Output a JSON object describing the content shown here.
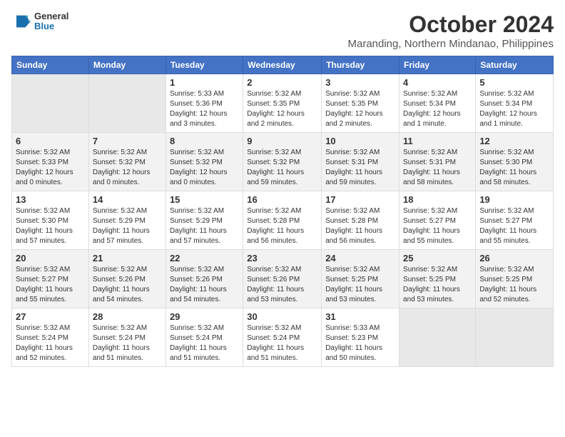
{
  "logo": {
    "general": "General",
    "blue": "Blue"
  },
  "title": "October 2024",
  "location": "Maranding, Northern Mindanao, Philippines",
  "headers": [
    "Sunday",
    "Monday",
    "Tuesday",
    "Wednesday",
    "Thursday",
    "Friday",
    "Saturday"
  ],
  "weeks": [
    [
      {
        "day": "",
        "info": ""
      },
      {
        "day": "",
        "info": ""
      },
      {
        "day": "1",
        "info": "Sunrise: 5:33 AM\nSunset: 5:36 PM\nDaylight: 12 hours and 3 minutes."
      },
      {
        "day": "2",
        "info": "Sunrise: 5:32 AM\nSunset: 5:35 PM\nDaylight: 12 hours and 2 minutes."
      },
      {
        "day": "3",
        "info": "Sunrise: 5:32 AM\nSunset: 5:35 PM\nDaylight: 12 hours and 2 minutes."
      },
      {
        "day": "4",
        "info": "Sunrise: 5:32 AM\nSunset: 5:34 PM\nDaylight: 12 hours and 1 minute."
      },
      {
        "day": "5",
        "info": "Sunrise: 5:32 AM\nSunset: 5:34 PM\nDaylight: 12 hours and 1 minute."
      }
    ],
    [
      {
        "day": "6",
        "info": "Sunrise: 5:32 AM\nSunset: 5:33 PM\nDaylight: 12 hours and 0 minutes."
      },
      {
        "day": "7",
        "info": "Sunrise: 5:32 AM\nSunset: 5:32 PM\nDaylight: 12 hours and 0 minutes."
      },
      {
        "day": "8",
        "info": "Sunrise: 5:32 AM\nSunset: 5:32 PM\nDaylight: 12 hours and 0 minutes."
      },
      {
        "day": "9",
        "info": "Sunrise: 5:32 AM\nSunset: 5:32 PM\nDaylight: 11 hours and 59 minutes."
      },
      {
        "day": "10",
        "info": "Sunrise: 5:32 AM\nSunset: 5:31 PM\nDaylight: 11 hours and 59 minutes."
      },
      {
        "day": "11",
        "info": "Sunrise: 5:32 AM\nSunset: 5:31 PM\nDaylight: 11 hours and 58 minutes."
      },
      {
        "day": "12",
        "info": "Sunrise: 5:32 AM\nSunset: 5:30 PM\nDaylight: 11 hours and 58 minutes."
      }
    ],
    [
      {
        "day": "13",
        "info": "Sunrise: 5:32 AM\nSunset: 5:30 PM\nDaylight: 11 hours and 57 minutes."
      },
      {
        "day": "14",
        "info": "Sunrise: 5:32 AM\nSunset: 5:29 PM\nDaylight: 11 hours and 57 minutes."
      },
      {
        "day": "15",
        "info": "Sunrise: 5:32 AM\nSunset: 5:29 PM\nDaylight: 11 hours and 57 minutes."
      },
      {
        "day": "16",
        "info": "Sunrise: 5:32 AM\nSunset: 5:28 PM\nDaylight: 11 hours and 56 minutes."
      },
      {
        "day": "17",
        "info": "Sunrise: 5:32 AM\nSunset: 5:28 PM\nDaylight: 11 hours and 56 minutes."
      },
      {
        "day": "18",
        "info": "Sunrise: 5:32 AM\nSunset: 5:27 PM\nDaylight: 11 hours and 55 minutes."
      },
      {
        "day": "19",
        "info": "Sunrise: 5:32 AM\nSunset: 5:27 PM\nDaylight: 11 hours and 55 minutes."
      }
    ],
    [
      {
        "day": "20",
        "info": "Sunrise: 5:32 AM\nSunset: 5:27 PM\nDaylight: 11 hours and 55 minutes."
      },
      {
        "day": "21",
        "info": "Sunrise: 5:32 AM\nSunset: 5:26 PM\nDaylight: 11 hours and 54 minutes."
      },
      {
        "day": "22",
        "info": "Sunrise: 5:32 AM\nSunset: 5:26 PM\nDaylight: 11 hours and 54 minutes."
      },
      {
        "day": "23",
        "info": "Sunrise: 5:32 AM\nSunset: 5:26 PM\nDaylight: 11 hours and 53 minutes."
      },
      {
        "day": "24",
        "info": "Sunrise: 5:32 AM\nSunset: 5:25 PM\nDaylight: 11 hours and 53 minutes."
      },
      {
        "day": "25",
        "info": "Sunrise: 5:32 AM\nSunset: 5:25 PM\nDaylight: 11 hours and 53 minutes."
      },
      {
        "day": "26",
        "info": "Sunrise: 5:32 AM\nSunset: 5:25 PM\nDaylight: 11 hours and 52 minutes."
      }
    ],
    [
      {
        "day": "27",
        "info": "Sunrise: 5:32 AM\nSunset: 5:24 PM\nDaylight: 11 hours and 52 minutes."
      },
      {
        "day": "28",
        "info": "Sunrise: 5:32 AM\nSunset: 5:24 PM\nDaylight: 11 hours and 51 minutes."
      },
      {
        "day": "29",
        "info": "Sunrise: 5:32 AM\nSunset: 5:24 PM\nDaylight: 11 hours and 51 minutes."
      },
      {
        "day": "30",
        "info": "Sunrise: 5:32 AM\nSunset: 5:24 PM\nDaylight: 11 hours and 51 minutes."
      },
      {
        "day": "31",
        "info": "Sunrise: 5:33 AM\nSunset: 5:23 PM\nDaylight: 11 hours and 50 minutes."
      },
      {
        "day": "",
        "info": ""
      },
      {
        "day": "",
        "info": ""
      }
    ]
  ]
}
